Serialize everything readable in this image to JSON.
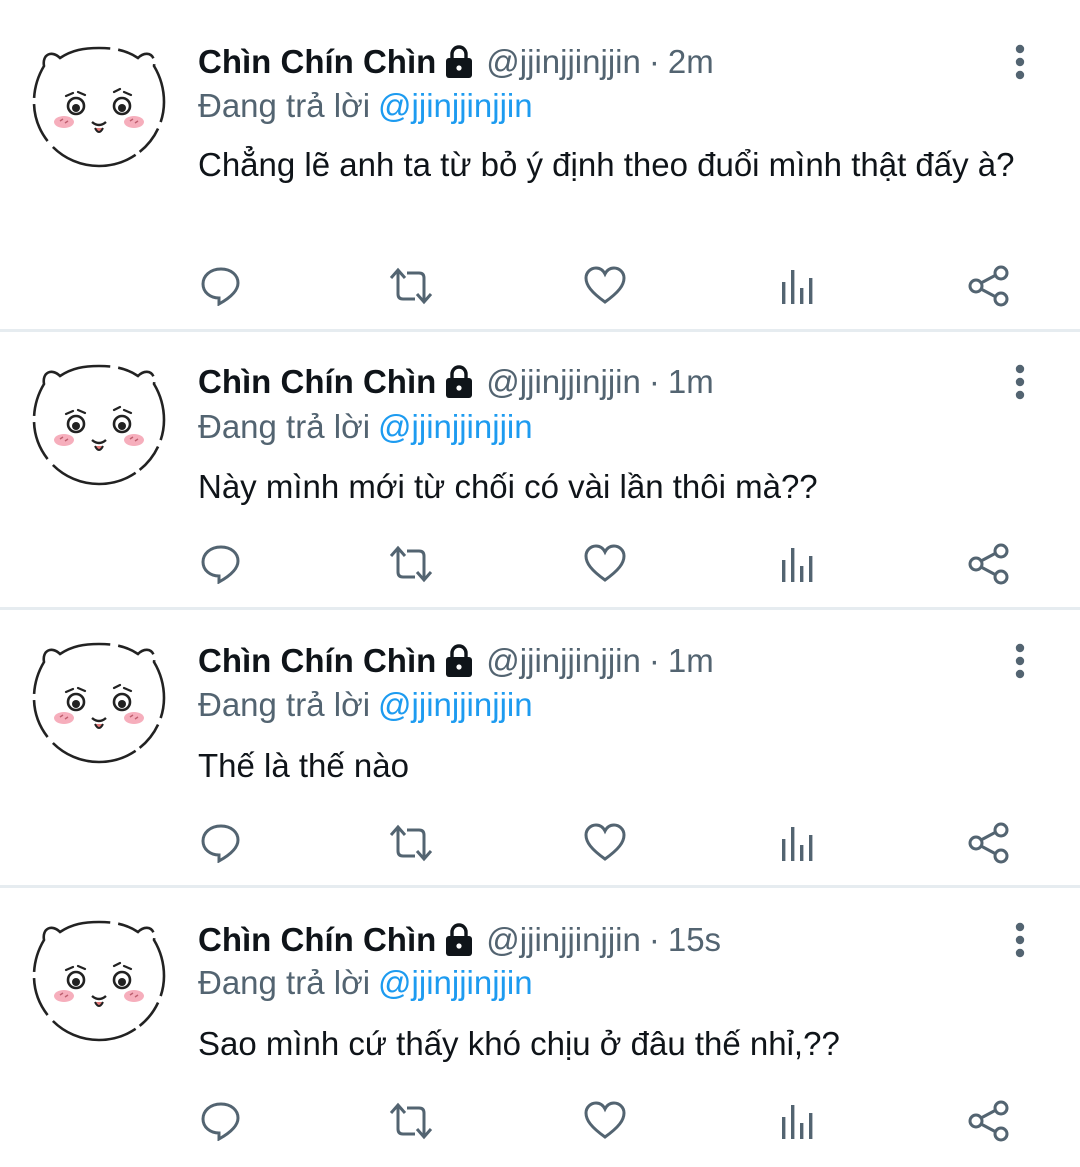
{
  "colors": {
    "link_blue": "#1d9bf0",
    "secondary_text": "#536471",
    "primary_text": "#0f1419",
    "divider": "#e6ecf0",
    "avatar_blush": "#f4a0b0"
  },
  "icons": {
    "lock": "lock-icon",
    "more": "more-vertical-icon",
    "reply": "reply-icon",
    "retweet": "retweet-icon",
    "like": "heart-icon",
    "views": "bar-chart-icon",
    "share": "share-icon"
  },
  "tweets": [
    {
      "display_name": "Chìn Chín Chìn",
      "handle": "@jjinjjinjjin",
      "separator": "·",
      "time": "2m",
      "reply_prefix": "Đang trả lời",
      "reply_to": "@jjinjjinjjin",
      "text": "Chẳng lẽ anh ta từ bỏ ý định theo đuổi mình thật đấy à?"
    },
    {
      "display_name": "Chìn Chín Chìn",
      "handle": "@jjinjjinjjin",
      "separator": "·",
      "time": "1m",
      "reply_prefix": "Đang trả lời",
      "reply_to": "@jjinjjinjjin",
      "text": "Này mình mới từ chối có vài lần thôi mà??"
    },
    {
      "display_name": "Chìn Chín Chìn",
      "handle": "@jjinjjinjjin",
      "separator": "·",
      "time": "1m",
      "reply_prefix": "Đang trả lời",
      "reply_to": "@jjinjjinjjin",
      "text": "Thế là thế nào"
    },
    {
      "display_name": "Chìn Chín Chìn",
      "handle": "@jjinjjinjjin",
      "separator": "·",
      "time": "15s",
      "reply_prefix": "Đang trả lời",
      "reply_to": "@jjinjjinjjin",
      "text": "Sao mình cứ thấy khó chịu ở đâu thế nhỉ,??"
    }
  ]
}
